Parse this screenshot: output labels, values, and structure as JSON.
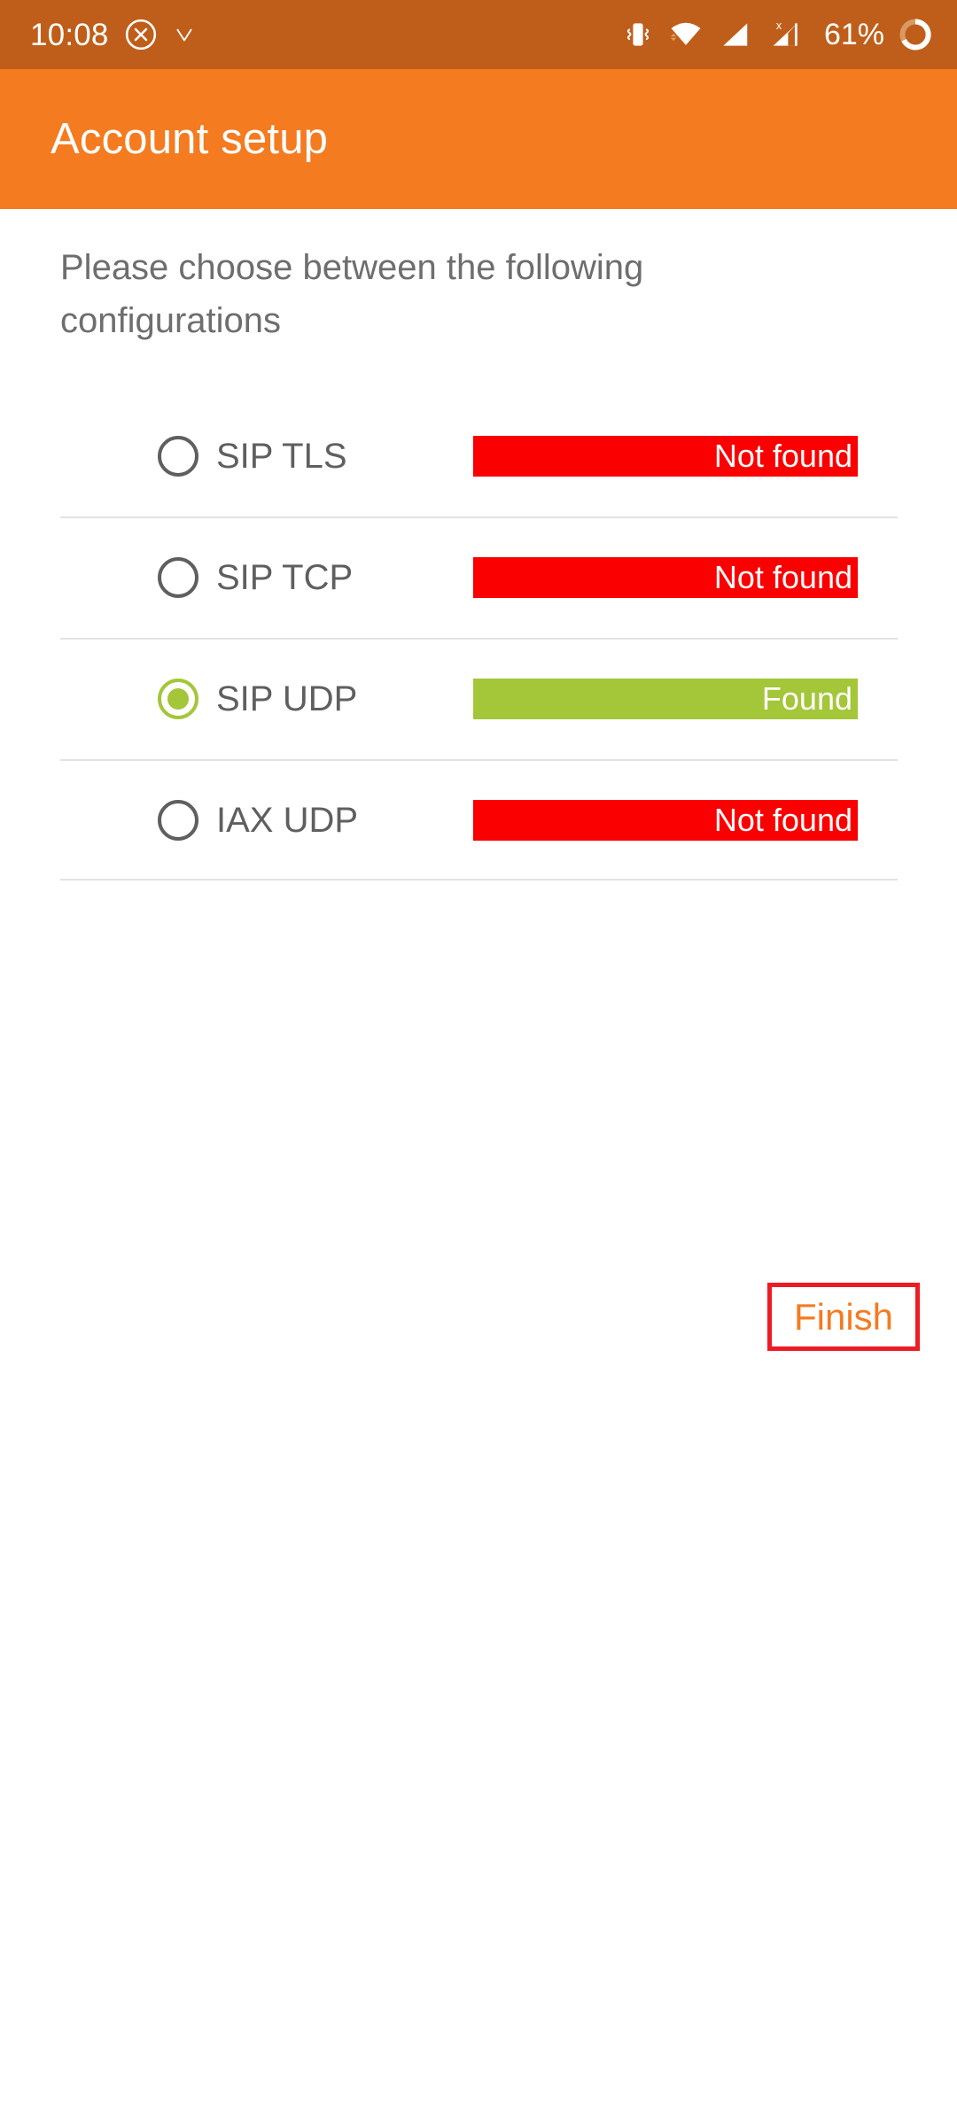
{
  "status_bar": {
    "clock": "10:08",
    "battery_percent": "61%",
    "icons": [
      "clock-text",
      "circled-x-icon",
      "chevron-v-icon",
      "vibrate-icon",
      "wifi-icon",
      "signal-bars-icon",
      "signal-no-service-icon",
      "battery-charging-icon"
    ],
    "colors": {
      "background": "#bf5e1a",
      "foreground": "#ffffff"
    }
  },
  "app_bar": {
    "title": "Account setup",
    "colors": {
      "background": "#f47b20",
      "title": "#ffffff"
    }
  },
  "content": {
    "instruction": "Please choose between the following configurations",
    "options": [
      {
        "label": "SIP TLS",
        "selected": false,
        "status": "Not found",
        "status_kind": "not-found"
      },
      {
        "label": "SIP TCP",
        "selected": false,
        "status": "Not found",
        "status_kind": "not-found"
      },
      {
        "label": "SIP UDP",
        "selected": true,
        "status": "Found",
        "status_kind": "found"
      },
      {
        "label": "IAX UDP",
        "selected": false,
        "status": "Not found",
        "status_kind": "not-found"
      }
    ],
    "finish_button": "Finish"
  },
  "colors": {
    "status_not_found": "#fa0000",
    "status_found": "#a4c639",
    "accent_orange": "#f47b20",
    "status_bar_orange": "#bf5e1a",
    "highlight_border_red": "#ed1c24",
    "text_gray": "#5f5f5f",
    "divider": "#e2e2e2"
  }
}
